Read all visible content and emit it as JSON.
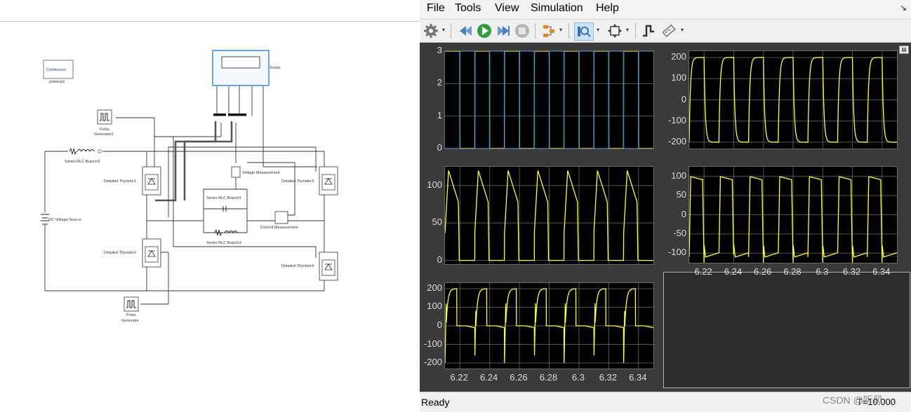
{
  "model": {
    "powergui": {
      "title": "Continuous",
      "label": "powergui"
    },
    "scope_label": "Scope",
    "pulse_gen2": [
      "Pulse",
      "Generator2"
    ],
    "pulse_gen": [
      "Pulse",
      "Generator"
    ],
    "series_rlc3": "Series RLC Branch3",
    "series_rlc1": "Series RLC Branch1",
    "series_rlc2": "Series RLC Branch2",
    "thyristor1": "Detailed Thyristor1",
    "thyristor2": "Detailed Thyristor2",
    "thyristor3": "Detailed Thyristor3",
    "thyristor4": "Detailed Thyristor4",
    "dc_source": "DC Voltage Source",
    "voltage_meas": "Voltage Measurement",
    "current_meas": "Current Measurement"
  },
  "scope": {
    "menu": [
      "File",
      "Tools",
      "View",
      "Simulation",
      "Help"
    ],
    "toolbar_icons": [
      "configuration-icon",
      "step-back-icon",
      "run-icon",
      "step-forward-icon",
      "stop-icon",
      "highlight-signal-icon",
      "zoom-icon",
      "fit-axes-icon",
      "triggers-icon",
      "measurements-icon"
    ],
    "status": "Ready",
    "time": "T=10.000",
    "plots": [
      {
        "yticks": [
          "3",
          "2",
          "1",
          "0"
        ],
        "xticks": []
      },
      {
        "yticks": [
          "200",
          "100",
          "0",
          "-100",
          "-200"
        ],
        "xticks": []
      },
      {
        "yticks": [
          "100",
          "50",
          "0"
        ],
        "xticks": []
      },
      {
        "yticks": [
          "100",
          "50",
          "0",
          "-50",
          "-100"
        ],
        "xticks": [
          "6.22",
          "6.24",
          "6.26",
          "6.28",
          "6.3",
          "6.32",
          "6.34"
        ]
      },
      {
        "yticks": [
          "200",
          "100",
          "0",
          "-100",
          "-200"
        ],
        "xticks": [
          "6.22",
          "6.24",
          "6.26",
          "6.28",
          "6.3",
          "6.32",
          "6.34"
        ]
      }
    ],
    "colors": {
      "trace_yellow": "#ffff33",
      "trace_blue": "#2f8fe0",
      "grid": "#555555",
      "background": "#000000"
    }
  },
  "chart_data": [
    {
      "type": "line",
      "x": [
        6.21,
        6.35
      ],
      "ylim": [
        0,
        3
      ],
      "series": [
        {
          "color": "#ffff33",
          "shape": "square",
          "low": 0,
          "high": 3,
          "period": 0.02,
          "duty": 0.5
        },
        {
          "color": "#2f8fe0",
          "shape": "square",
          "low": 0,
          "high": 3,
          "period": 0.02,
          "duty": 0.5,
          "phase": 0.5
        }
      ]
    },
    {
      "type": "line",
      "x": [
        6.21,
        6.35
      ],
      "ylim": [
        -230,
        230
      ],
      "series": [
        {
          "color": "#ffff33",
          "shape": "exp-square",
          "amplitude": 200,
          "period": 0.02
        }
      ]
    },
    {
      "type": "line",
      "x": [
        6.21,
        6.35
      ],
      "ylim": [
        -5,
        125
      ],
      "series": [
        {
          "color": "#ffff33",
          "shape": "rectified-pulse",
          "peak": 120,
          "base": 0,
          "period": 0.02
        }
      ]
    },
    {
      "type": "line",
      "x": [
        6.21,
        6.35
      ],
      "ylim": [
        -125,
        125
      ],
      "series": [
        {
          "color": "#ffff33",
          "shape": "trapezoid-square",
          "amplitude": 110,
          "period": 0.02
        }
      ]
    },
    {
      "type": "line",
      "x": [
        6.21,
        6.35
      ],
      "ylim": [
        -230,
        230
      ],
      "series": [
        {
          "color": "#ffff33",
          "shape": "chopped",
          "amplitude": 200,
          "period": 0.02
        }
      ]
    }
  ]
}
